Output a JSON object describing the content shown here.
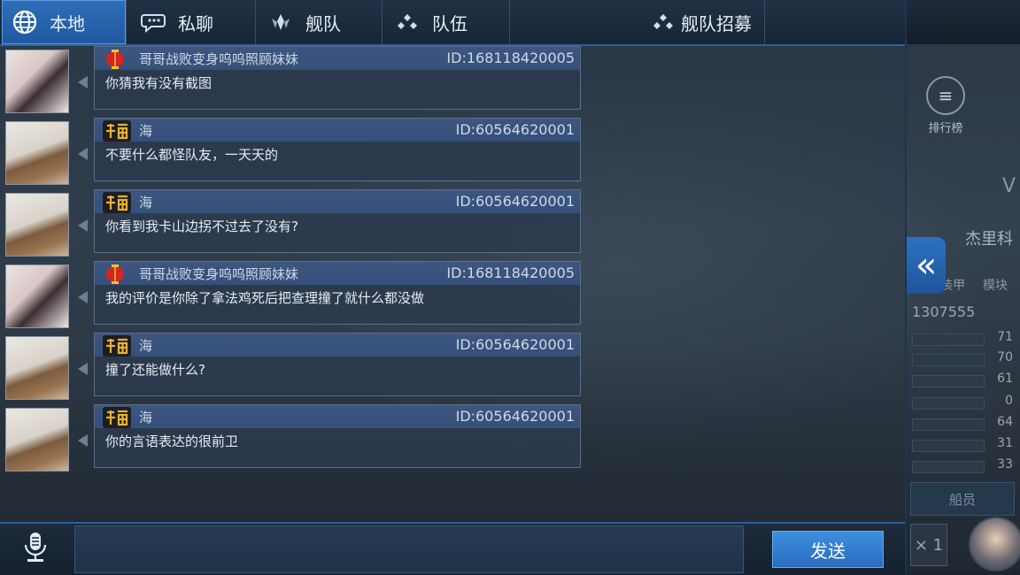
{
  "tabs": [
    {
      "label": "本地",
      "icon": "globe-icon"
    },
    {
      "label": "私聊",
      "icon": "chat-bubble-icon"
    },
    {
      "label": "舰队",
      "icon": "fleet-emblem-icon"
    },
    {
      "label": "队伍",
      "icon": "team-dots-icon"
    },
    {
      "label": "舰队招募",
      "icon": "recruit-dots-icon"
    }
  ],
  "messages": [
    {
      "name": "哥哥战败变身呜呜照顾妹妹",
      "uid": "ID:168118420005",
      "text": "你猜我有没有截图",
      "badge": "lantern-badge-icon",
      "avatar": "anime-girls-avatar"
    },
    {
      "name": "海",
      "uid": "ID:60564620001",
      "text": "不要什么都怪队友，一天天的",
      "badge": "fu-badge-icon",
      "avatar": "man-with-dog-avatar"
    },
    {
      "name": "海",
      "uid": "ID:60564620001",
      "text": "你看到我卡山边拐不过去了没有?",
      "badge": "fu-badge-icon",
      "avatar": "man-with-dog-avatar"
    },
    {
      "name": "哥哥战败变身呜呜照顾妹妹",
      "uid": "ID:168118420005",
      "text": "我的评价是你除了拿法鸡死后把查理撞了就什么都没做",
      "badge": "lantern-badge-icon",
      "avatar": "anime-girls-avatar"
    },
    {
      "name": "海",
      "uid": "ID:60564620001",
      "text": "撞了还能做什么?",
      "badge": "fu-badge-icon",
      "avatar": "man-with-dog-avatar"
    },
    {
      "name": "海",
      "uid": "ID:60564620001",
      "text": "你的言语表达的很前卫",
      "badge": "fu-badge-icon",
      "avatar": "man-with-dog-avatar"
    }
  ],
  "input": {
    "value": "",
    "placeholder": ""
  },
  "send_label": "发送",
  "side": {
    "ranking_label": "排行榜",
    "collapse_glyph": "«",
    "ship_name": "杰里科",
    "armor_label": "装甲",
    "module_label": "模块",
    "id_number": "1307555",
    "stats": [
      "71",
      "70",
      "61",
      "0",
      "64",
      "31",
      "33"
    ],
    "crew_label": "船员",
    "multiplier": "× 1",
    "letter_v": "V"
  },
  "colors": {
    "accent": "#2f6fb8",
    "send": "#3d8fe0",
    "bubble_head": "#3d5680"
  }
}
